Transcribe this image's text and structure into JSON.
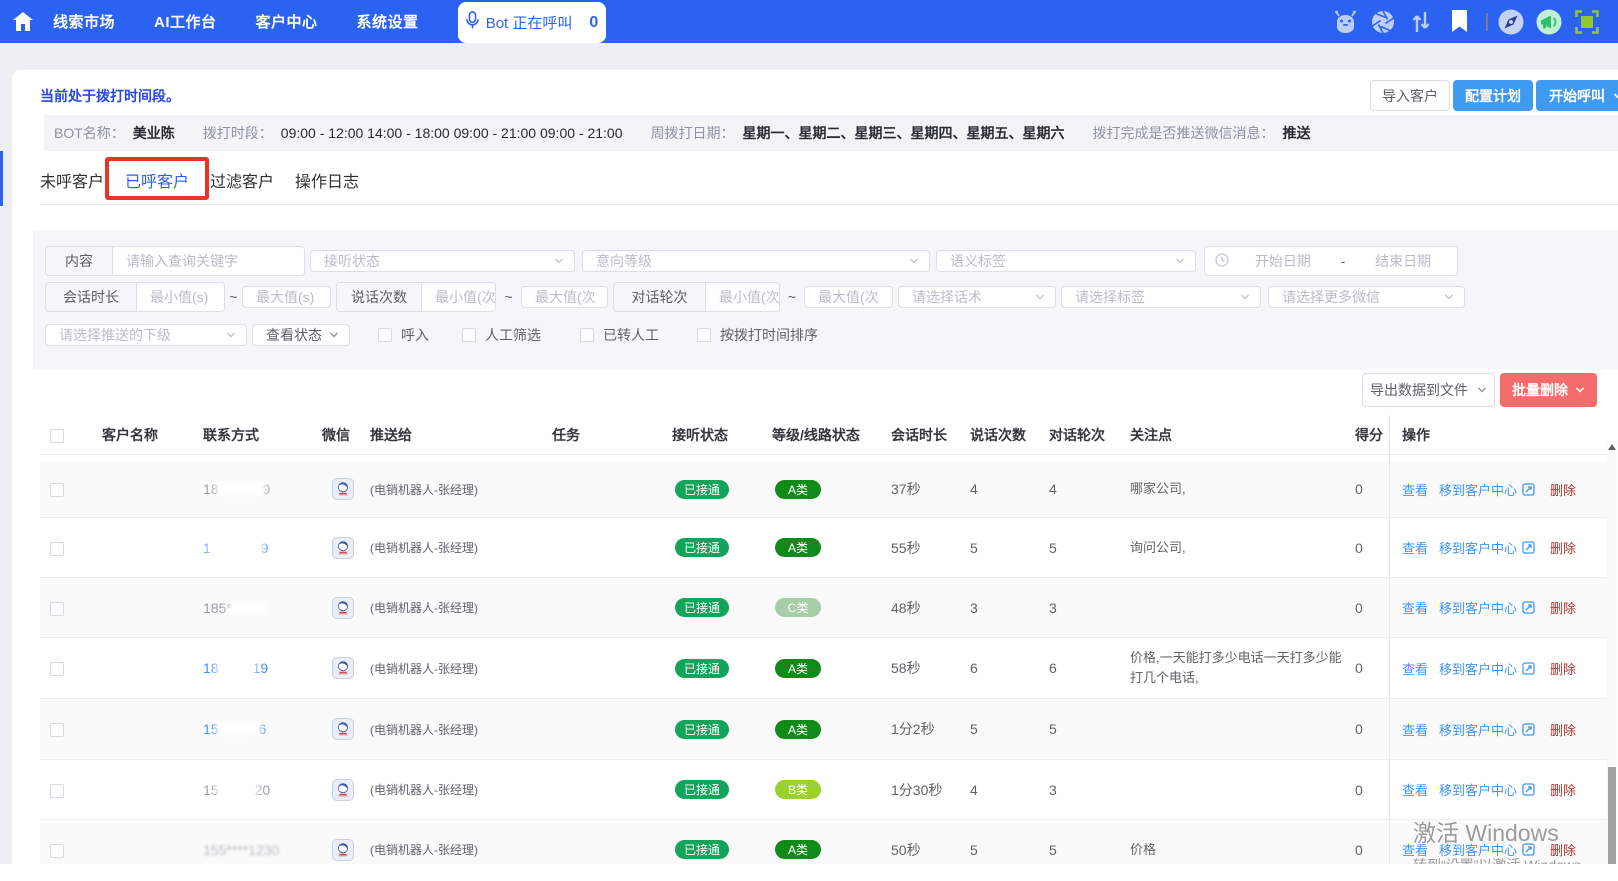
{
  "topbar": {
    "nav": [
      "线索市场",
      "AI工作台",
      "客户中心",
      "系统设置"
    ],
    "bot_status": {
      "label": "Bot 正在呼叫",
      "count": "0"
    },
    "icons": [
      "robot-icon",
      "aperture-icon",
      "sort-arrows-icon",
      "bookmark-icon",
      "compass-icon",
      "megaphone-icon",
      "screenshot-icon"
    ]
  },
  "page": {
    "status_text": "当前处于拨打时间段。",
    "actions": {
      "import": "导入客户",
      "configure": "配置计划",
      "start_call": "开始呼叫"
    },
    "info": [
      {
        "label": "BOT名称：",
        "value": "美业陈",
        "bold": true
      },
      {
        "label": "拨打时段：",
        "value": "09:00 - 12:00 14:00 - 18:00 09:00 - 21:00 09:00 - 21:00",
        "bold": false
      },
      {
        "label": "周拨打日期：",
        "value": "星期一、星期二、星期三、星期四、星期五、星期六",
        "bold": true
      },
      {
        "label": "拨打完成是否推送微信消息：",
        "value": "推送",
        "bold": true
      }
    ],
    "tabs": [
      {
        "label": "未呼客户",
        "active": false
      },
      {
        "label": "已呼客户",
        "active": true,
        "annotated": true
      },
      {
        "label": "过滤客户",
        "active": false
      },
      {
        "label": "操作日志",
        "active": false
      }
    ]
  },
  "filters": {
    "content_label": "内容",
    "content_placeholder": "请输入查询关键字",
    "answer_state": "接听状态",
    "intent_level": "意向等级",
    "semantic_tag": "语义标签",
    "date_start": "开始日期",
    "date_separator": "-",
    "date_end": "结束日期",
    "duration_label": "会话时长",
    "duration_min": "最小值(s)",
    "duration_max": "最大值(s)",
    "talk_label": "说话次数",
    "talk_min": "最小值(次",
    "talk_max": "最大值(次",
    "round_label": "对话轮次",
    "round_min": "最小值(次",
    "round_max": "最大值(次",
    "range_separator": "~",
    "script_select": "请选择话术",
    "tag_select": "请选择标签",
    "wechat_select": "请选择更多微信",
    "push_sub_select": "请选择推送的下级",
    "view_state": "查看状态",
    "checkboxes": [
      "呼入",
      "人工筛选",
      "已转人工",
      "按拨打时间排序"
    ]
  },
  "toolbar": {
    "export": "导出数据到文件",
    "batch_delete": "批量删除"
  },
  "table": {
    "columns": [
      "客户名称",
      "联系方式",
      "微信",
      "推送给",
      "任务",
      "接听状态",
      "等级/线路状态",
      "会话时长",
      "说话次数",
      "对话轮次",
      "关注点",
      "得分",
      "操作"
    ],
    "actions": {
      "view": "查看",
      "move": "移到客户中心",
      "del": "删除"
    },
    "rows": [
      {
        "phone_prefix": "18",
        "phone_suffix": "9",
        "phone_link": false,
        "pushed": "(电销机器人-张经理)",
        "answer": "已接通",
        "grade": "A类",
        "grade_type": "a",
        "duration": "37秒",
        "talks": "4",
        "rounds": "4",
        "focus": "哪家公司,",
        "score": "0"
      },
      {
        "phone_prefix": "1",
        "phone_suffix": "9",
        "phone_link": true,
        "pushed": "(电销机器人-张经理)",
        "answer": "已接通",
        "grade": "A类",
        "grade_type": "a",
        "duration": "55秒",
        "talks": "5",
        "rounds": "5",
        "focus": "询问公司,",
        "score": "0"
      },
      {
        "phone_prefix": "185*",
        "phone_suffix": "",
        "phone_link": false,
        "pushed": "(电销机器人-张经理)",
        "answer": "已接通",
        "grade": "C类",
        "grade_type": "c",
        "duration": "48秒",
        "talks": "3",
        "rounds": "3",
        "focus": "",
        "score": "0"
      },
      {
        "phone_prefix": "18",
        "phone_suffix": "19",
        "phone_link": true,
        "pushed": "(电销机器人-张经理)",
        "answer": "已接通",
        "grade": "A类",
        "grade_type": "a",
        "duration": "58秒",
        "talks": "6",
        "rounds": "6",
        "focus": "价格,一天能打多少电话一天打多少能打几个电话,",
        "score": "0"
      },
      {
        "phone_prefix": "15",
        "phone_suffix": "6",
        "phone_link": true,
        "pushed": "(电销机器人-张经理)",
        "answer": "已接通",
        "grade": "A类",
        "grade_type": "a",
        "duration": "1分2秒",
        "talks": "5",
        "rounds": "5",
        "focus": "",
        "score": "0"
      },
      {
        "phone_prefix": "15",
        "phone_suffix": "20",
        "phone_link": false,
        "pushed": "(电销机器人-张经理)",
        "answer": "已接通",
        "grade": "B类",
        "grade_type": "b",
        "duration": "1分30秒",
        "talks": "4",
        "rounds": "3",
        "focus": "",
        "score": "0"
      },
      {
        "phone_prefix": "155****1230",
        "phone_suffix": "",
        "phone_link": false,
        "pushed": "(电销机器人-张经理)",
        "answer": "已接通",
        "grade": "A类",
        "grade_type": "a",
        "duration": "50秒",
        "talks": "5",
        "rounds": "5",
        "focus": "价格",
        "score": "0"
      }
    ]
  },
  "watermark": {
    "line1": "激活 Windows",
    "line2": "转到“设置”以激活 Windows。"
  },
  "colors": {
    "topbar": "#2b62f2",
    "primary_button": "#3f9af2",
    "danger_button": "#f56c6c",
    "answered_badge": "#13a45b",
    "grade_a": "#128a1a",
    "grade_b": "#9cd02f",
    "grade_c": "#a6cda6",
    "link": "#3d96f5",
    "delete_link": "#b3352e",
    "annotation": "#e8352a",
    "status_text": "#2a47e0"
  }
}
